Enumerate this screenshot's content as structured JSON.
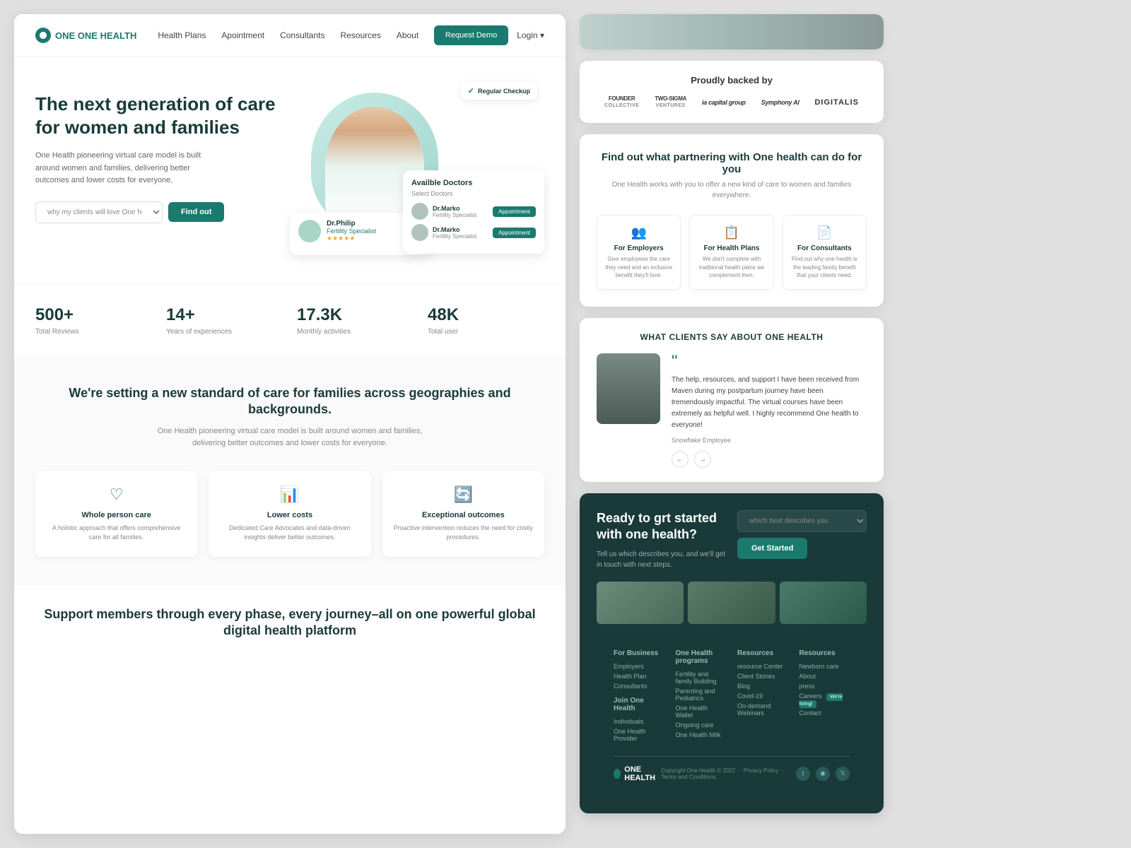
{
  "nav": {
    "logo": "ONE HEALTH",
    "links": [
      "Health Plans",
      "Apointment",
      "Consultants",
      "Resources",
      "About"
    ],
    "demo_btn": "Request Demo",
    "login": "Login"
  },
  "hero": {
    "title": "The next generation of care for women and families",
    "description": "One Health pioneering virtual care model is built around women and families, delivering better outcomes and lower costs for everyone.",
    "select_placeholder": "why my clients will love One health",
    "find_btn": "Find out",
    "doctor_name": "Dr.Philip",
    "doctor_spec": "Fertility Specialist",
    "checkup_badge": "Regular Checkup",
    "available_title": "Availble Doctors",
    "available_subtitle": "Select Doctors",
    "doc1_name": "Dr.Marko",
    "doc1_spec": "Fertility Specialist",
    "doc2_name": "Dr.Marko",
    "doc2_spec": "Fertility Specialist",
    "appt_btn": "Appointment"
  },
  "stats": [
    {
      "num": "500+",
      "label": "Total Reviews"
    },
    {
      "num": "14+",
      "label": "Years of experiences"
    },
    {
      "num": "17.3K",
      "label": "Monthly activities"
    },
    {
      "num": "48K",
      "label": "Total user"
    }
  ],
  "standard": {
    "title": "We're setting a new standard of care for families across geographies and backgrounds.",
    "desc": "One Health pioneering virtual care model is built around women and families, delivering better outcomes and lower costs for everyone.",
    "features": [
      {
        "icon": "♡",
        "title": "Whole person care",
        "desc": "A holistic approach that offers comprehensive care for all families."
      },
      {
        "icon": "📊",
        "title": "Lower costs",
        "desc": "Dedicated Care Advocates and data-driven insights deliver better outcomes."
      },
      {
        "icon": "🔄",
        "title": "Exceptional outcomes",
        "desc": "Proactive intervention reduces the need for costly procedures."
      }
    ]
  },
  "support": {
    "title": "Support members through every phase, every journey–all on one powerful global digital health platform"
  },
  "backed": {
    "title": "Proudly backed by",
    "backers": [
      {
        "name": "FOUNDER\nCOLLECTIVE",
        "style": "bold"
      },
      {
        "name": "TWO-SIGMA\nVENTURES",
        "style": "normal"
      },
      {
        "name": "ia capital group",
        "style": "italic"
      },
      {
        "name": "Symphony AI",
        "style": "normal"
      },
      {
        "name": "DIGITALIS",
        "style": "bold"
      }
    ]
  },
  "partner": {
    "title": "Find out what partnering with One health can do for you",
    "desc": "One Health works with you to offer a new kind of care to women and families everywhere.",
    "options": [
      {
        "icon": "👥",
        "title": "For Employers",
        "desc": "Give employees the care they need and an inclusive benefit they'll love."
      },
      {
        "icon": "📋",
        "title": "For Health Plans",
        "desc": "We don't complete with traditional health plans we complement then."
      },
      {
        "icon": "📄",
        "title": "For Consultants",
        "desc": "Find out why one health is the leading family benefit that your clients need."
      }
    ]
  },
  "testimonial": {
    "section_title": "WHAT CLIENTS SAY ABOUT ONE HEALTH",
    "quote": "The help, resources, and support I have been received from Maven during my postpartum journey have been tremendously impactful. The virtual courses have been extremely as helpful well. I highly recommend One health to everyone!",
    "author": "Snowflake Employee"
  },
  "cta": {
    "title": "Ready to grt started with one health?",
    "desc": "Tell us which describes you, and we'll get in touch with next steps.",
    "select_placeholder": "which best describes you",
    "btn": "Get Started"
  },
  "footer": {
    "cols": [
      {
        "title": "For Business",
        "links": [
          "Employers",
          "Health Plan",
          "Consultants"
        ]
      },
      {
        "title": "One Health programs",
        "links": [
          "Fertility and family Building",
          "Parenting and Pediatrics",
          "One Health Wallet",
          "Ongoing care",
          "One Health Milk"
        ]
      },
      {
        "title": "Resources",
        "links": [
          "resource Center",
          "Client Stories",
          "Blog",
          "Covid-19",
          "On-demand Webinars"
        ]
      },
      {
        "title": "Resources",
        "links": [
          "Newborn care",
          "About",
          "press",
          "Careers",
          "Contact"
        ],
        "badge_index": 3,
        "badge_text": "We're hiring!"
      }
    ],
    "join_title": "Join One Health",
    "join_links": [
      "Individuals",
      "One Health Provider"
    ],
    "copyright": "Copyright One Health © 2022",
    "legal_links": [
      "Privacy Policy",
      "Terms and Conditions"
    ],
    "logo": "ONE HEALTH"
  }
}
